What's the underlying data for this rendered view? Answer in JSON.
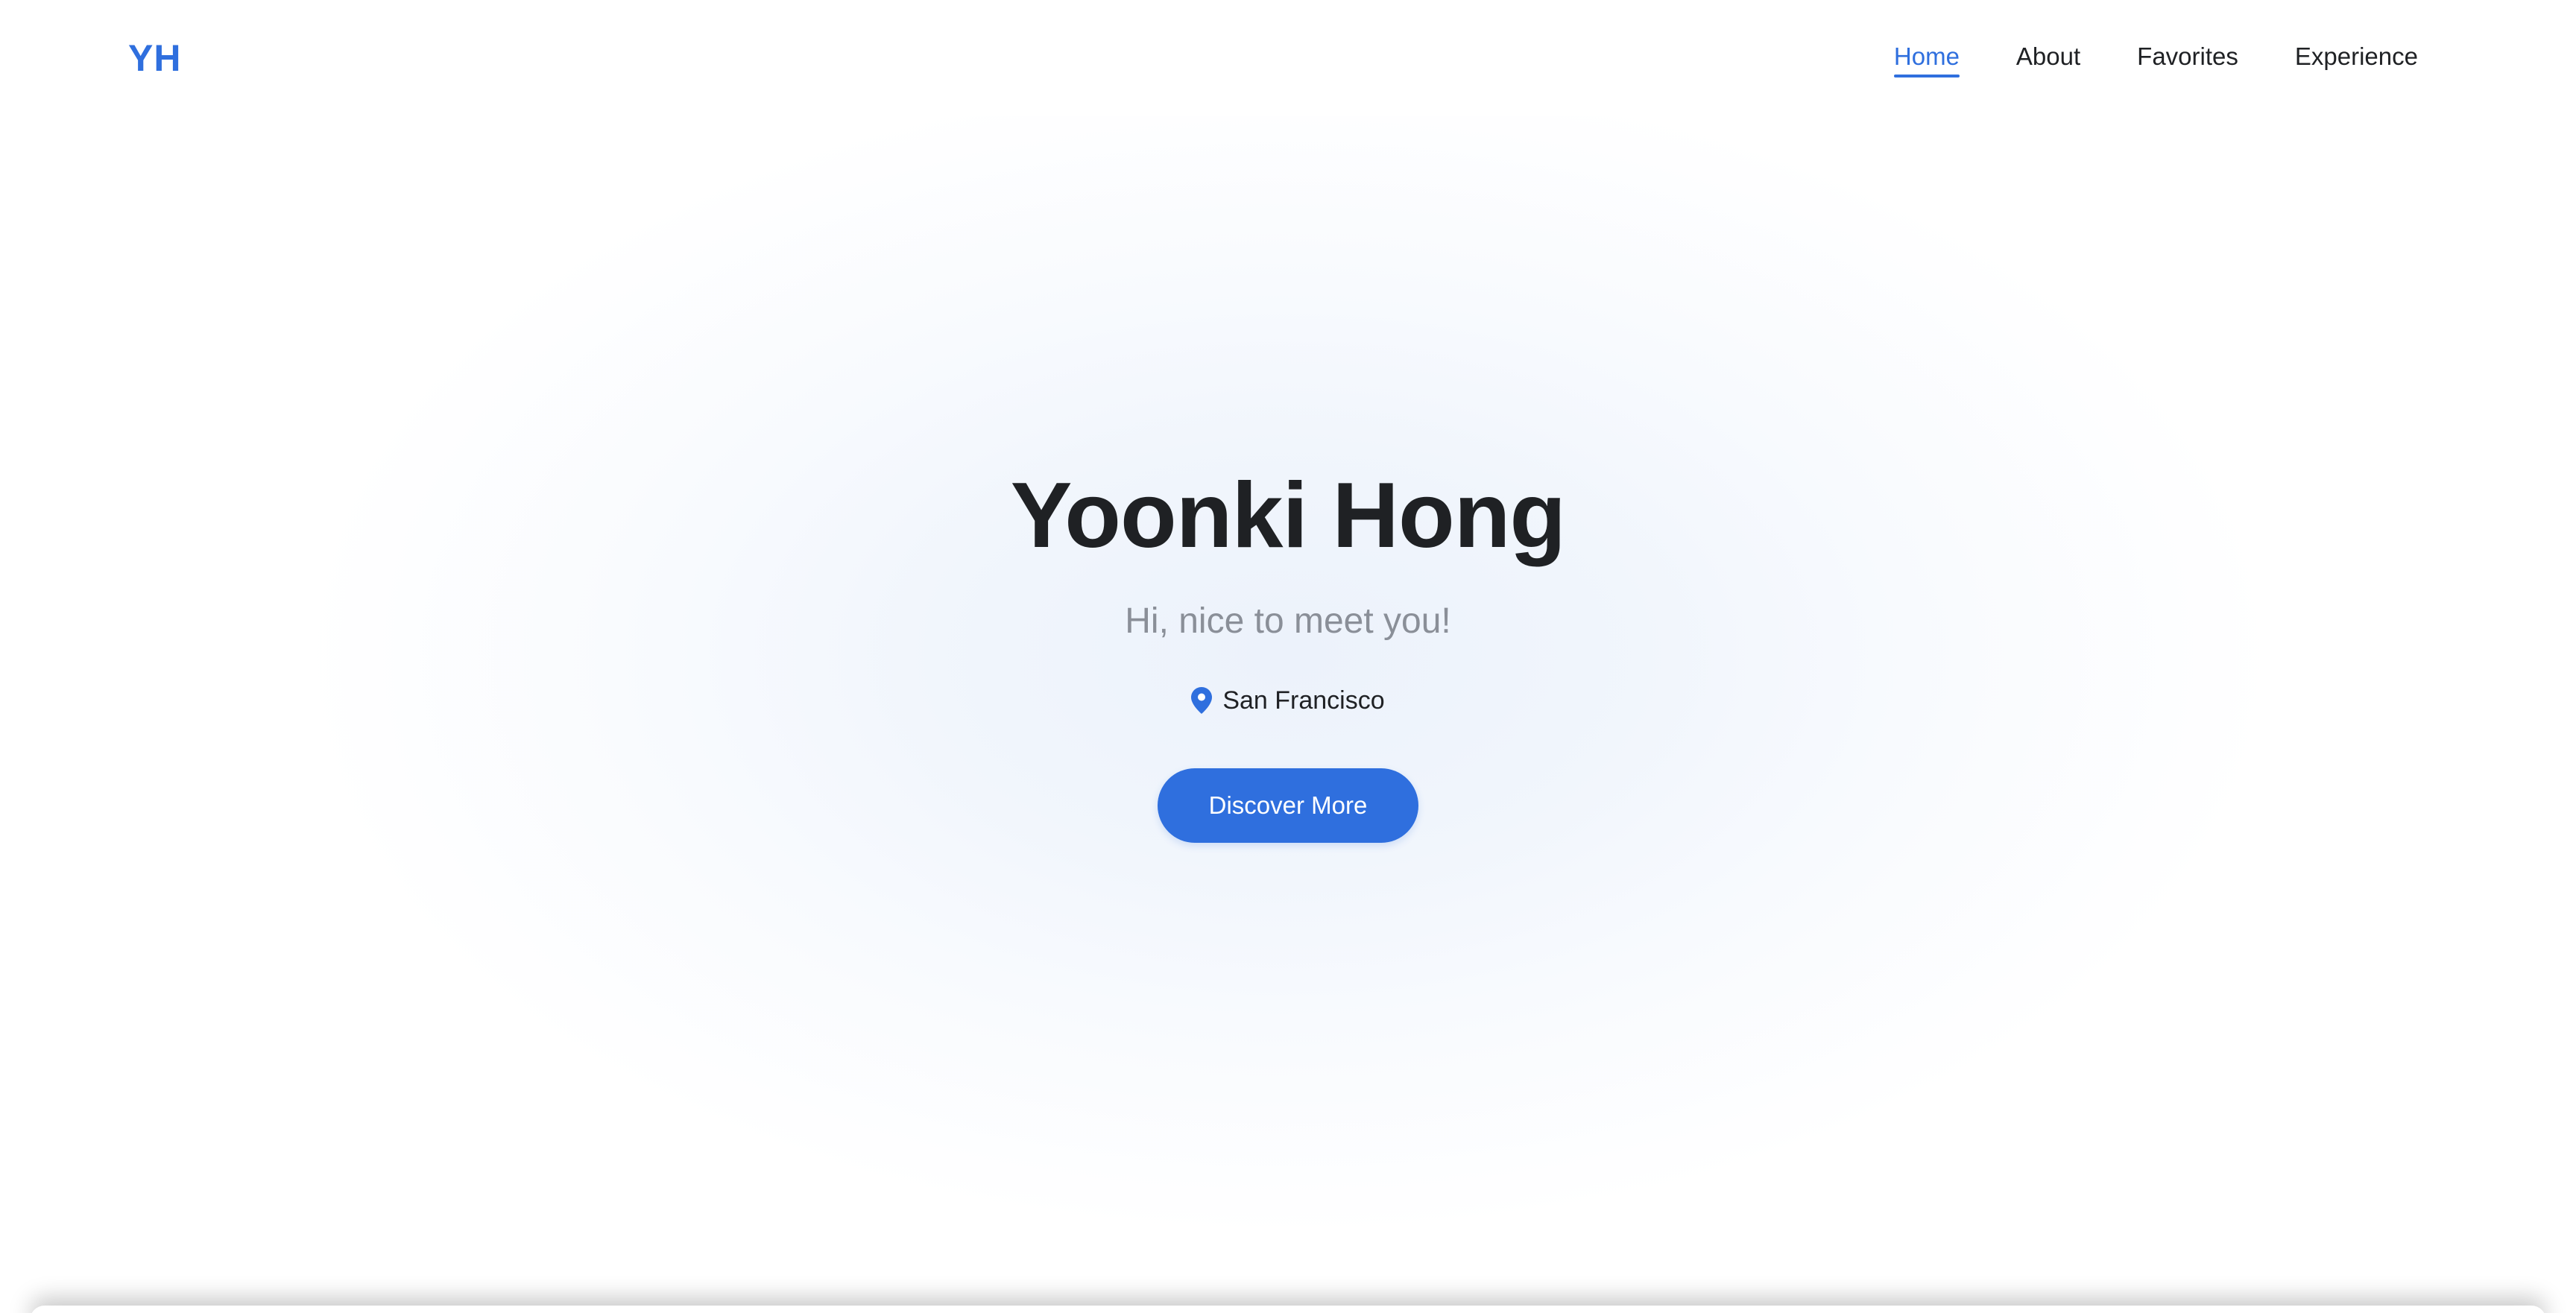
{
  "header": {
    "logo": "YH",
    "nav": [
      {
        "label": "Home",
        "active": true
      },
      {
        "label": "About",
        "active": false
      },
      {
        "label": "Favorites",
        "active": false
      },
      {
        "label": "Experience",
        "active": false
      }
    ]
  },
  "hero": {
    "title": "Yoonki Hong",
    "subtitle": "Hi, nice to meet you!",
    "location": {
      "icon": "map-pin-icon",
      "text": "San Francisco"
    },
    "cta_label": "Discover More"
  },
  "colors": {
    "accent": "#2f6fde",
    "text": "#1f2124",
    "muted": "#8a8f98",
    "hero_background": "#ecf2fb"
  }
}
